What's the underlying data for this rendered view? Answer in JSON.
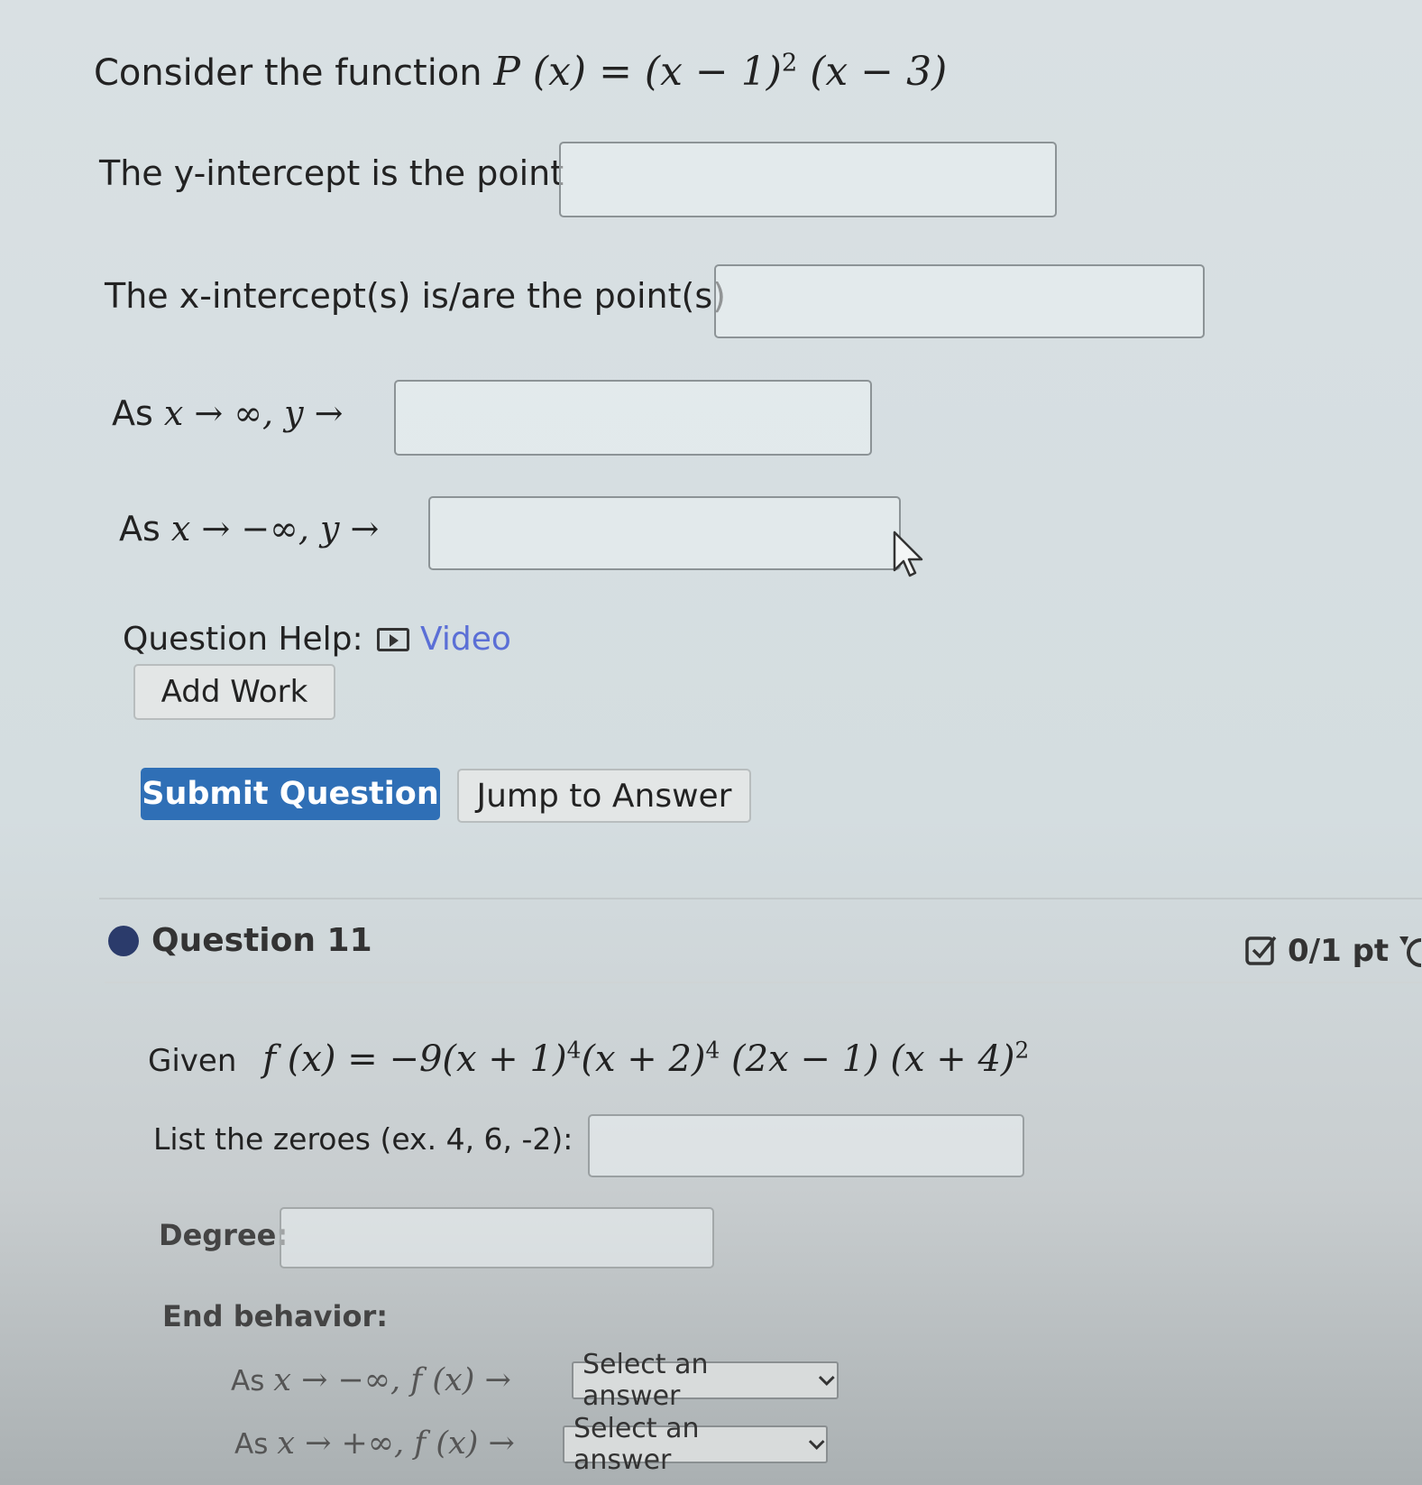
{
  "q10": {
    "intro": "Consider the function",
    "func": "P (x) = (x − 1)",
    "func_exp": "2",
    "func_tail": " (x − 3)",
    "y_intercept_label": "The y-intercept is the point",
    "x_intercept_label": "The x-intercept(s) is/are the point(s)",
    "end_pos_prefix": "As",
    "end_pos_math": "x → ∞, y →",
    "end_neg_prefix": "As",
    "end_neg_math": "x → −∞, y →",
    "help_label": "Question Help:",
    "video_label": "Video",
    "add_work_label": "Add Work",
    "submit_label": "Submit Question",
    "jump_label": "Jump to Answer"
  },
  "q11": {
    "title": "Question 11",
    "points": "0/1 pt",
    "given_label": "Given",
    "f_part1": "f (x) = −9(x + 1)",
    "f_exp1": "4",
    "f_part2": "(x + 2)",
    "f_exp2": "4",
    "f_part3": " (2x − 1) (x + 4)",
    "f_exp3": "2",
    "zeroes_label": "List the zeroes (ex. 4, 6, -2):",
    "degree_label": "Degree:",
    "end_behavior_label": "End behavior:",
    "neg_prefix": "As",
    "neg_math": "x → −∞, f (x) →",
    "pos_prefix": "As",
    "pos_math": "x → +∞, f (x) →",
    "select_placeholder": "Select an answer"
  },
  "icons": [
    "video-play-icon",
    "status-dot-icon",
    "checkbox-score-icon",
    "retry-icon",
    "mouse-cursor-icon",
    "dropdown-chevron-icon"
  ],
  "colors": {
    "primary_button": "#2f6fb6",
    "link": "#5b6fd6",
    "status_dot": "#2b3b6b"
  }
}
